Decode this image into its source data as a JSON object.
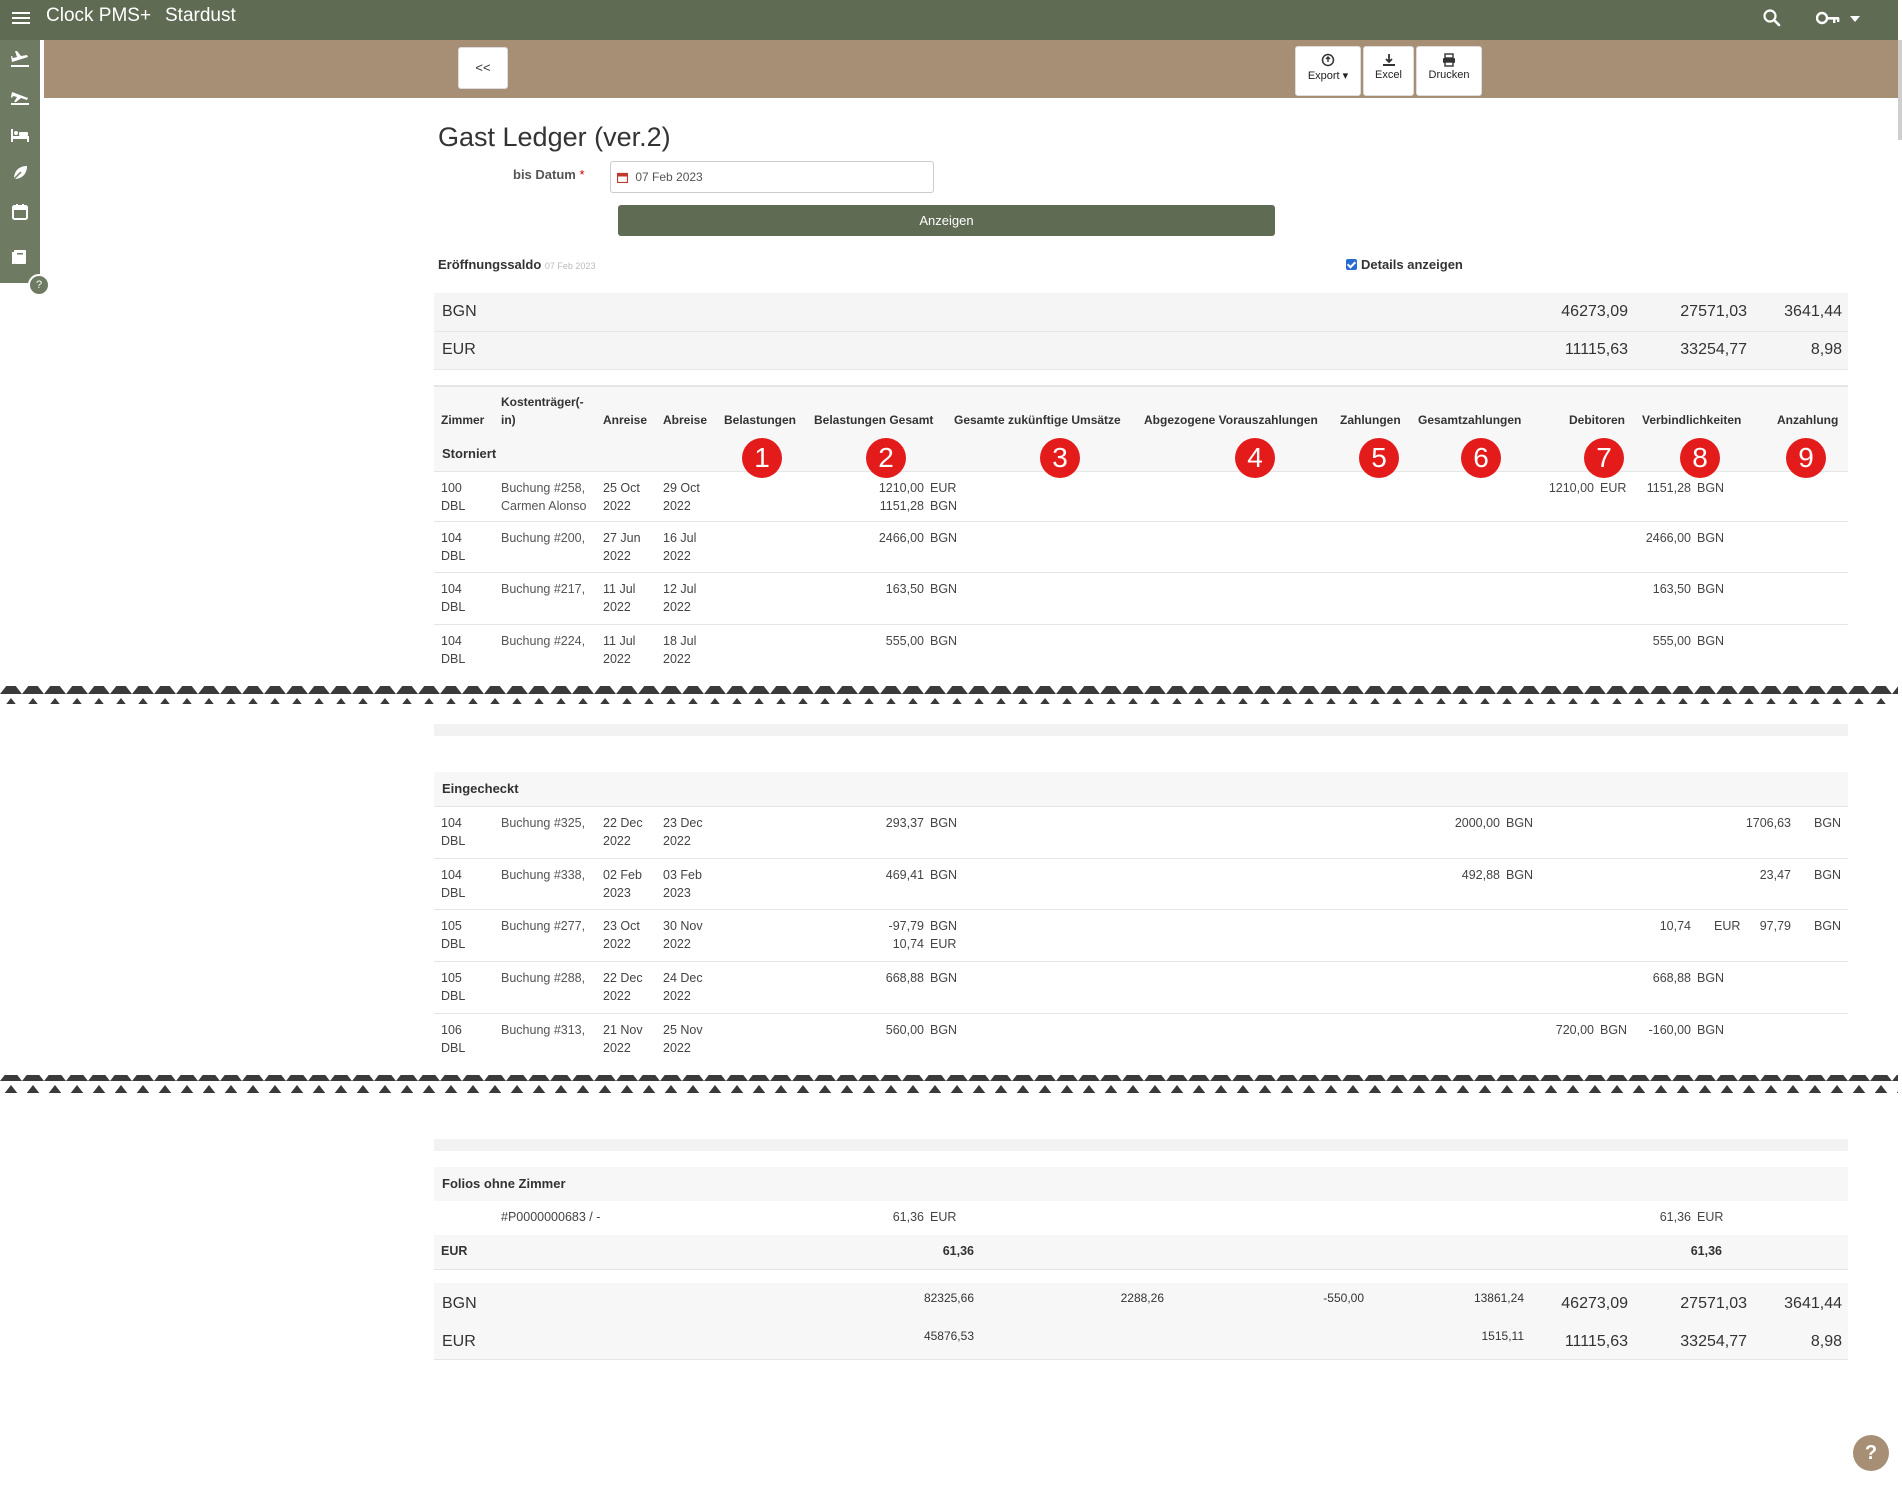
{
  "app": {
    "name": "Clock PMS+",
    "property": "Stardust"
  },
  "toolbar": {
    "back": "<<",
    "export": "Export ▾",
    "excel": "Excel",
    "print": "Drucken"
  },
  "page": {
    "title": "Gast Ledger (ver.2)",
    "date_label": "bis Datum",
    "date_required": "*",
    "date_value": "07 Feb 2023",
    "show_button": "Anzeigen",
    "opening_label": "Eröffnungssaldo",
    "opening_date": "07 Feb 2023",
    "details_label": "Details anzeigen"
  },
  "opening_totals": [
    {
      "currency": "BGN",
      "debitoren": "46273,09",
      "verbindlichkeiten": "27571,03",
      "anzahlung": "3641,44"
    },
    {
      "currency": "EUR",
      "debitoren": "11115,63",
      "verbindlichkeiten": "33254,77",
      "anzahlung": "8,98"
    }
  ],
  "columns": {
    "zimmer": "Zimmer",
    "kostentraeger_a": "Kostenträger(-",
    "kostentraeger_b": "in)",
    "anreise": "Anreise",
    "abreise": "Abreise",
    "belastungen": "Belastungen",
    "belastungen_gesamt": "Belastungen Gesamt",
    "zukuenftige": "Gesamte zukünftige Umsätze",
    "vorauszahlungen": "Abgezogene Vorauszahlungen",
    "zahlungen": "Zahlungen",
    "gesamtzahlungen": "Gesamtzahlungen",
    "debitoren": "Debitoren",
    "verbindlichkeiten": "Verbindlichkeiten",
    "anzahlung": "Anzahlung"
  },
  "badges": [
    "1",
    "2",
    "3",
    "4",
    "5",
    "6",
    "7",
    "8",
    "9"
  ],
  "sections": {
    "storniert": "Storniert",
    "eingecheckt": "Eingecheckt",
    "folios": "Folios ohne Zimmer"
  },
  "storniert_rows": [
    {
      "room1": "100",
      "room2": "DBL",
      "k1": "Buchung #258,",
      "k2": "Carmen Alonso",
      "a1": "25 Oct",
      "a2": "2022",
      "d1": "29 Oct",
      "d2": "2022",
      "bg1": "1210,00",
      "bg1c": "EUR",
      "bg2": "1151,28",
      "bg2c": "BGN",
      "deb": "1210,00",
      "debc": "EUR",
      "ver": "1151,28",
      "verc": "BGN"
    },
    {
      "room1": "104",
      "room2": "DBL",
      "k1": "Buchung #200,",
      "k2": "",
      "a1": "27 Jun",
      "a2": "2022",
      "d1": "16 Jul",
      "d2": "2022",
      "bg1": "2466,00",
      "bg1c": "BGN",
      "bg2": "",
      "bg2c": "",
      "deb": "",
      "debc": "",
      "ver": "2466,00",
      "verc": "BGN"
    },
    {
      "room1": "104",
      "room2": "DBL",
      "k1": "Buchung #217,",
      "k2": "",
      "a1": "11 Jul",
      "a2": "2022",
      "d1": "12 Jul",
      "d2": "2022",
      "bg1": "163,50",
      "bg1c": "BGN",
      "bg2": "",
      "bg2c": "",
      "deb": "",
      "debc": "",
      "ver": "163,50",
      "verc": "BGN"
    },
    {
      "room1": "104",
      "room2": "DBL",
      "k1": "Buchung #224,",
      "k2": "",
      "a1": "11 Jul",
      "a2": "2022",
      "d1": "18 Jul",
      "d2": "2022",
      "bg1": "555,00",
      "bg1c": "BGN",
      "bg2": "",
      "bg2c": "",
      "deb": "",
      "debc": "",
      "ver": "555,00",
      "verc": "BGN"
    }
  ],
  "eingecheckt_rows": [
    {
      "room1": "104",
      "room2": "DBL",
      "k1": "Buchung #325,",
      "a1": "22 Dec",
      "a2": "2022",
      "d1": "23 Dec",
      "d2": "2022",
      "bg1": "293,37",
      "bg1c": "BGN",
      "bg2": "",
      "bg2c": "",
      "gz": "2000,00",
      "gzc": "BGN",
      "deb": "",
      "debc": "",
      "ver": "",
      "verc": "",
      "anz": "1706,63",
      "anzc": "BGN"
    },
    {
      "room1": "104",
      "room2": "DBL",
      "k1": "Buchung #338,",
      "a1": "02 Feb",
      "a2": "2023",
      "d1": "03 Feb",
      "d2": "2023",
      "bg1": "469,41",
      "bg1c": "BGN",
      "bg2": "",
      "bg2c": "",
      "gz": "492,88",
      "gzc": "BGN",
      "deb": "",
      "debc": "",
      "ver": "",
      "verc": "",
      "anz": "23,47",
      "anzc": "BGN"
    },
    {
      "room1": "105",
      "room2": "DBL",
      "k1": "Buchung #277,",
      "a1": "23 Oct",
      "a2": "2022",
      "d1": "30 Nov",
      "d2": "2022",
      "bg1": "-97,79",
      "bg1c": "BGN",
      "bg2": "10,74",
      "bg2c": "EUR",
      "gz": "",
      "gzc": "",
      "deb": "",
      "debc": "",
      "ver": "10,74",
      "verc": "EUR",
      "anz": "97,79",
      "anzc": "BGN"
    },
    {
      "room1": "105",
      "room2": "DBL",
      "k1": "Buchung #288,",
      "a1": "22 Dec",
      "a2": "2022",
      "d1": "24 Dec",
      "d2": "2022",
      "bg1": "668,88",
      "bg1c": "BGN",
      "bg2": "",
      "bg2c": "",
      "gz": "",
      "gzc": "",
      "deb": "",
      "debc": "",
      "ver": "668,88",
      "verc": "BGN",
      "anz": "",
      "anzc": ""
    },
    {
      "room1": "106",
      "room2": "DBL",
      "k1": "Buchung #313,",
      "a1": "21 Nov",
      "a2": "2022",
      "d1": "25 Nov",
      "d2": "2022",
      "bg1": "560,00",
      "bg1c": "BGN",
      "bg2": "",
      "bg2c": "",
      "gz": "",
      "gzc": "",
      "deb": "720,00",
      "debc": "BGN",
      "ver": "-160,00",
      "verc": "BGN",
      "anz": "",
      "anzc": ""
    }
  ],
  "folio_row": {
    "id": "#P0000000683 / -",
    "bg": "61,36",
    "bgc": "EUR",
    "ver": "61,36",
    "verc": "EUR"
  },
  "folio_total": {
    "currency": "EUR",
    "bg": "61,36",
    "ver": "61,36"
  },
  "grand_totals": [
    {
      "currency": "BGN",
      "bg": "82325,66",
      "zuk": "2288,26",
      "vor": "-550,00",
      "gz": "13861,24",
      "deb": "46273,09",
      "ver": "27571,03",
      "anz": "3641,44"
    },
    {
      "currency": "EUR",
      "bg": "45876,53",
      "zuk": "",
      "vor": "",
      "gz": "1515,11",
      "deb": "11115,63",
      "ver": "33254,77",
      "anz": "8,98"
    }
  ]
}
